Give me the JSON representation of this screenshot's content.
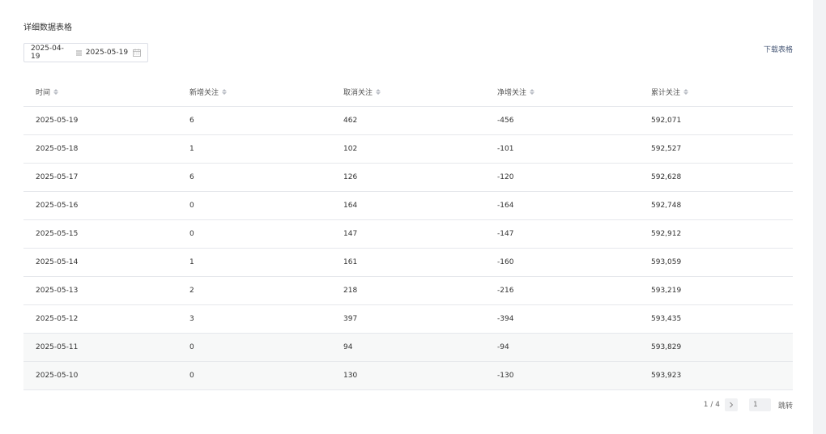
{
  "section": {
    "title": "详细数据表格"
  },
  "date_range": {
    "start": "2025-04-19",
    "end": "2025-05-19"
  },
  "download_label": "下载表格",
  "table": {
    "headers": [
      "时间",
      "新增关注",
      "取消关注",
      "净增关注",
      "累计关注"
    ],
    "rows": [
      [
        "2025-05-19",
        "6",
        "462",
        "-456",
        "592,071"
      ],
      [
        "2025-05-18",
        "1",
        "102",
        "-101",
        "592,527"
      ],
      [
        "2025-05-17",
        "6",
        "126",
        "-120",
        "592,628"
      ],
      [
        "2025-05-16",
        "0",
        "164",
        "-164",
        "592,748"
      ],
      [
        "2025-05-15",
        "0",
        "147",
        "-147",
        "592,912"
      ],
      [
        "2025-05-14",
        "1",
        "161",
        "-160",
        "593,059"
      ],
      [
        "2025-05-13",
        "2",
        "218",
        "-216",
        "593,219"
      ],
      [
        "2025-05-12",
        "3",
        "397",
        "-394",
        "593,435"
      ],
      [
        "2025-05-11",
        "0",
        "94",
        "-94",
        "593,829"
      ],
      [
        "2025-05-10",
        "0",
        "130",
        "-130",
        "593,923"
      ]
    ]
  },
  "pagination": {
    "status": "1 / 4",
    "input_placeholder": "1",
    "jump_label": "跳转"
  },
  "icons": {
    "separator": "range-separator-icon",
    "calendar": "calendar-icon",
    "sort": "sort-icon",
    "next": "chevron-right-icon"
  },
  "colors": {
    "background": "#f2f3f5",
    "card": "#ffffff",
    "border": "#e6e8ec",
    "link": "#4a5a78",
    "shaded_row": "#f7f8f8"
  }
}
